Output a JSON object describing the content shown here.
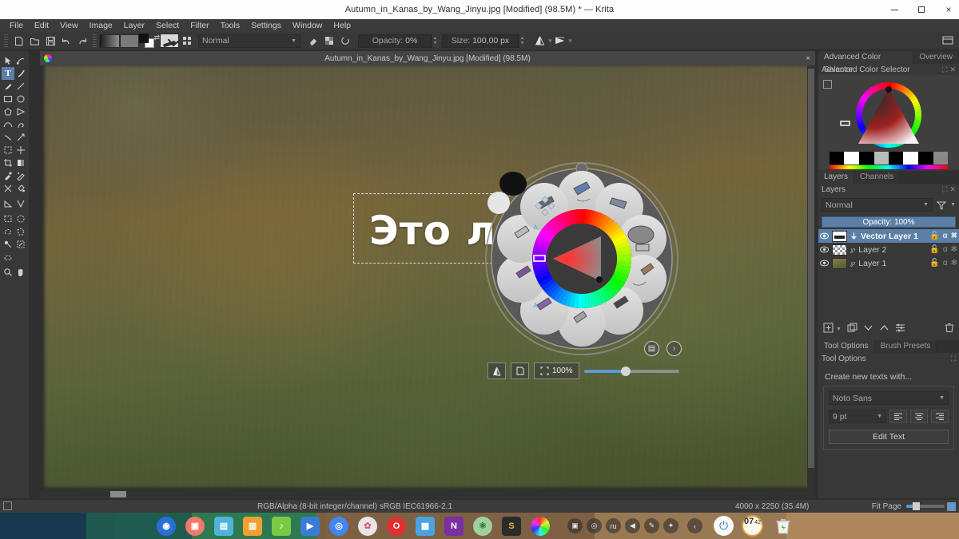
{
  "window": {
    "title": "Autumn_in_Kanas_by_Wang_Jinyu.jpg [Modified]  (98.5M) * — Krita",
    "minimize": "minimize-button",
    "maximize": "maximize-button",
    "close": "×"
  },
  "menubar": {
    "items": [
      "File",
      "Edit",
      "View",
      "Image",
      "Layer",
      "Select",
      "Filter",
      "Tools",
      "Settings",
      "Window",
      "Help"
    ]
  },
  "toolbar": {
    "blend_mode": "Normal",
    "opacity_label": "Opacity:",
    "opacity_value": "0%",
    "size_label": "Size:",
    "size_value": "100,00 px",
    "icons": [
      "new-document-icon",
      "open-document-icon",
      "save-icon",
      "undo-icon",
      "redo-icon",
      "gradient-swatch",
      "pattern-swatch",
      "foreground-background-swatch",
      "brush-preset-icon",
      "brush-presets-grid-icon",
      "eraser-toggle-icon",
      "alpha-lock-icon",
      "reload-preset-icon",
      "mirror-horizontal-icon",
      "mirror-vertical-icon",
      "workspace-icon"
    ]
  },
  "toolbox": {
    "tools": [
      {
        "name": "select-shapes-tool",
        "selected": false
      },
      {
        "name": "edit-shapes-tool",
        "selected": false
      },
      {
        "name": "text-tool",
        "selected": true
      },
      {
        "name": "calligraphy-tool",
        "selected": false
      },
      {
        "name": "freehand-brush-tool",
        "selected": false
      },
      {
        "name": "line-tool",
        "selected": false
      },
      {
        "name": "rectangle-tool",
        "selected": false
      },
      {
        "name": "ellipse-tool",
        "selected": false
      },
      {
        "name": "polygon-tool",
        "selected": false
      },
      {
        "name": "polyline-tool",
        "selected": false
      },
      {
        "name": "bezier-curve-tool",
        "selected": false
      },
      {
        "name": "freehand-path-tool",
        "selected": false
      },
      {
        "name": "dynamic-brush-tool",
        "selected": false
      },
      {
        "name": "multibrush-tool",
        "selected": false
      },
      {
        "name": "transform-tool",
        "selected": false
      },
      {
        "name": "move-tool",
        "selected": false
      },
      {
        "name": "crop-tool",
        "selected": false
      },
      {
        "name": "gradient-tool",
        "selected": false
      },
      {
        "name": "color-picker-tool",
        "selected": false
      },
      {
        "name": "smart-patch-tool",
        "selected": false
      },
      {
        "name": "colorize-mask-tool",
        "selected": false
      },
      {
        "name": "fill-tool",
        "selected": false
      },
      {
        "name": "measure-tool",
        "selected": false
      },
      {
        "name": "assistant-tool",
        "selected": false
      },
      {
        "name": "rectangular-selection-tool",
        "selected": false
      },
      {
        "name": "elliptical-selection-tool",
        "selected": false
      },
      {
        "name": "freehand-selection-tool",
        "selected": false
      },
      {
        "name": "polygonal-selection-tool",
        "selected": false
      },
      {
        "name": "contiguous-selection-tool",
        "selected": false
      },
      {
        "name": "similar-color-selection-tool",
        "selected": false
      },
      {
        "name": "bezier-selection-tool",
        "selected": false
      },
      {
        "name": "zoom-tool",
        "selected": false
      },
      {
        "name": "pan-tool",
        "selected": false
      }
    ]
  },
  "subwindow": {
    "title": "Autumn_in_Kanas_by_Wang_Jinyu.jpg [Modified]  (98.5M)",
    "close": "×"
  },
  "canvas": {
    "text_content": "Это л",
    "zoom_label": "100%",
    "zoom_icons": [
      "mirror-canvas-icon",
      "wrap-around-icon",
      "zoom-level-icon"
    ]
  },
  "palette": {
    "name": "popup-palette",
    "presets": [
      "eraser-soft-preset",
      "airbrush-preset",
      "soft-round-preset",
      "ink-pen-preset",
      "pencil-preset",
      "bristles-preset",
      "dry-brush-preset",
      "wet-paint-preset",
      "marker-preset",
      "move-handle-preset"
    ],
    "buttons": [
      "presets-list-button",
      "next-page-button"
    ]
  },
  "dock": {
    "color_selector": {
      "tabs": [
        {
          "label": "Advanced Color Selector",
          "active": true
        },
        {
          "label": "Overview",
          "active": false
        }
      ],
      "header": "Advanced Color Selector"
    },
    "layers": {
      "tabs": [
        {
          "label": "Layers",
          "active": true
        },
        {
          "label": "Channels",
          "active": false
        }
      ],
      "header": "Layers",
      "blend_mode": "Normal",
      "opacity_label": "Opacity:",
      "opacity_value": "100%",
      "rows": [
        {
          "name": "Vector Layer 1",
          "selected": true,
          "thumb": "vec",
          "visible": true
        },
        {
          "name": "Layer 2",
          "selected": false,
          "thumb": "checker",
          "visible": true
        },
        {
          "name": "Layer 1",
          "selected": false,
          "thumb": "img",
          "visible": true
        }
      ],
      "buttons": [
        "add-layer-button",
        "duplicate-layer-button",
        "move-layer-down-button",
        "move-layer-up-button",
        "layer-properties-button",
        "delete-layer-button"
      ]
    },
    "tool_options": {
      "tabs": [
        {
          "label": "Tool Options",
          "active": true
        },
        {
          "label": "Brush Presets",
          "active": false
        }
      ],
      "header": "Tool Options",
      "create_label": "Create new texts with...",
      "font_family": "Noto Sans",
      "font_size": "9 pt",
      "align_buttons": [
        "align-left-icon",
        "align-center-icon",
        "align-right-icon"
      ],
      "edit_text_button": "Edit Text"
    }
  },
  "statusbar": {
    "color_space": "RGB/Alpha (8-bit integer/channel)  sRGB IEC61966-2.1",
    "dimensions": "4000 x 2250 (35.4M)",
    "fit": "Fit Page"
  },
  "taskbar": {
    "apps": [
      {
        "name": "app-deepin-launcher",
        "glyph": "◉",
        "color": "#2a6fd6"
      },
      {
        "name": "app-recorder",
        "glyph": "▣",
        "color": "#f0796a"
      },
      {
        "name": "app-file-manager",
        "glyph": "▤",
        "color": "#4fb3d9"
      },
      {
        "name": "app-store",
        "glyph": "▥",
        "color": "#f0a030"
      },
      {
        "name": "app-music",
        "glyph": "♪",
        "color": "#7ac943"
      },
      {
        "name": "app-movie",
        "glyph": "▶",
        "color": "#3a7bd5"
      },
      {
        "name": "app-chrome",
        "glyph": "◎",
        "color": "#4285f4"
      },
      {
        "name": "app-settings",
        "glyph": "✿",
        "color": "#dddddd"
      },
      {
        "name": "app-opera",
        "glyph": "O",
        "color": "#e03030"
      },
      {
        "name": "app-calculator",
        "glyph": "▦",
        "color": "#4aa3e0"
      },
      {
        "name": "app-onenote",
        "glyph": "N",
        "color": "#7b2fa0"
      },
      {
        "name": "app-react",
        "glyph": "⚛",
        "color": "#9fd0a0"
      },
      {
        "name": "app-sublime",
        "glyph": "S",
        "color": "#2b2b2b"
      },
      {
        "name": "app-krita",
        "glyph": "◕",
        "color": "#c050b0"
      }
    ],
    "tray": [
      {
        "name": "tray-office-icon",
        "glyph": "▣"
      },
      {
        "name": "tray-chrome-icon",
        "glyph": "◎"
      },
      {
        "name": "tray-language-indicator",
        "glyph": "ru"
      },
      {
        "name": "tray-volume-icon",
        "glyph": "◀"
      },
      {
        "name": "tray-brightness-icon",
        "glyph": "✎"
      },
      {
        "name": "tray-bluetooth-icon",
        "glyph": "✦"
      },
      {
        "name": "tray-expand-icon",
        "glyph": "‹"
      }
    ],
    "power": "⏻",
    "clock_hours": "07",
    "clock_minutes": "42",
    "trash": "trash-icon"
  },
  "colors": {
    "accent": "#5b7fa6",
    "panel": "#383838",
    "panel_dark": "#303030",
    "text": "#c8c8c8"
  }
}
